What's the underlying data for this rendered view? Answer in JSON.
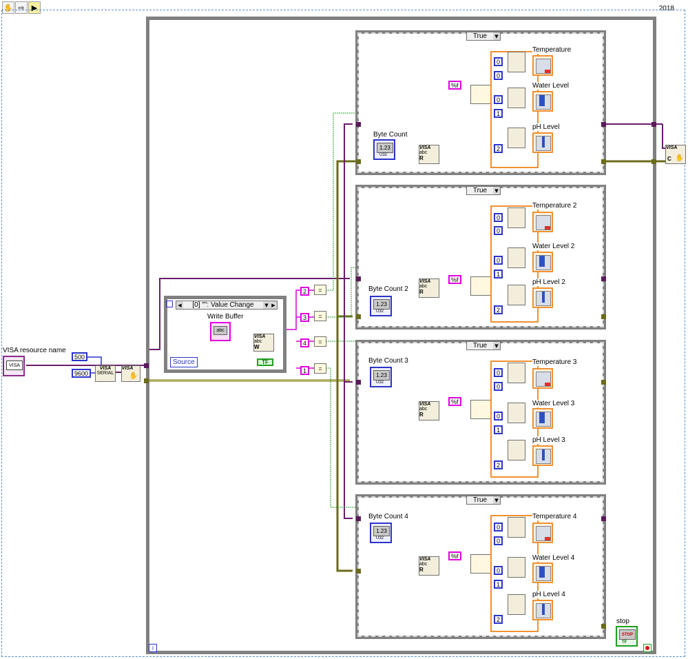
{
  "toolbar": {
    "run_icon": "hand-run-icon",
    "arrow_icon": "arrow-right-icon",
    "highlight_icon": "highlight-execution-icon",
    "version": "2018"
  },
  "visa_resource": {
    "label": "VISA resource name",
    "text": "VISA"
  },
  "serial": {
    "timeout": "500",
    "baud": "9600",
    "serial_label": "SERIAL",
    "visa_label": "VISA"
  },
  "event": {
    "case_label": "[0] \"\": Value Change",
    "write_buffer": "Write Buffer",
    "source": "Source",
    "tf": "TF",
    "write_node": "VISA",
    "abc": "abc",
    "W": "W"
  },
  "compare": [
    {
      "value": "2",
      "op": "="
    },
    {
      "value": "3",
      "op": "="
    },
    {
      "value": "4",
      "op": "="
    },
    {
      "value": "1",
      "op": "="
    }
  ],
  "cases": [
    {
      "selector": "True",
      "byte_count": "Byte Count",
      "format": "%f",
      "temperature": "Temperature",
      "water": "Water Level",
      "ph": "pH Level",
      "idx": [
        "0",
        "0",
        "0",
        "1",
        "2"
      ]
    },
    {
      "selector": "True",
      "byte_count": "Byte Count 2",
      "format": "%f",
      "temperature": "Temperature 2",
      "water": "Water Level 2",
      "ph": "pH Level 2",
      "idx": [
        "0",
        "0",
        "0",
        "1",
        "2"
      ]
    },
    {
      "selector": "True",
      "byte_count": "Byte Count 3",
      "format": "%f",
      "temperature": "Temperature 3",
      "water": "Water Level 3",
      "ph": "pH Level 3",
      "idx": [
        "0",
        "0",
        "0",
        "1",
        "2"
      ]
    },
    {
      "selector": "True",
      "byte_count": "Byte Count 4",
      "format": "%f",
      "temperature": "Temperature 4",
      "water": "Water Level 4",
      "ph": "pH Level 4",
      "idx": [
        "0",
        "0",
        "0",
        "1",
        "2"
      ]
    }
  ],
  "numeric_display": "1.23",
  "u32": "U32",
  "visa_read": {
    "visa": "VISA",
    "abc": "abc",
    "R": "R"
  },
  "close": {
    "visa": "VISA",
    "C": "C"
  },
  "stop": {
    "label": "stop",
    "button": "STOP",
    "tf": "TF"
  },
  "loop_iteration": "i",
  "colors": {
    "wire_pink": "#d000d0",
    "wire_purple": "#6b1a6b",
    "wire_blue": "#2a34c8",
    "wire_olive": "#6b6b1a",
    "wire_orange": "#f09030",
    "structure_gray": "#808080"
  }
}
